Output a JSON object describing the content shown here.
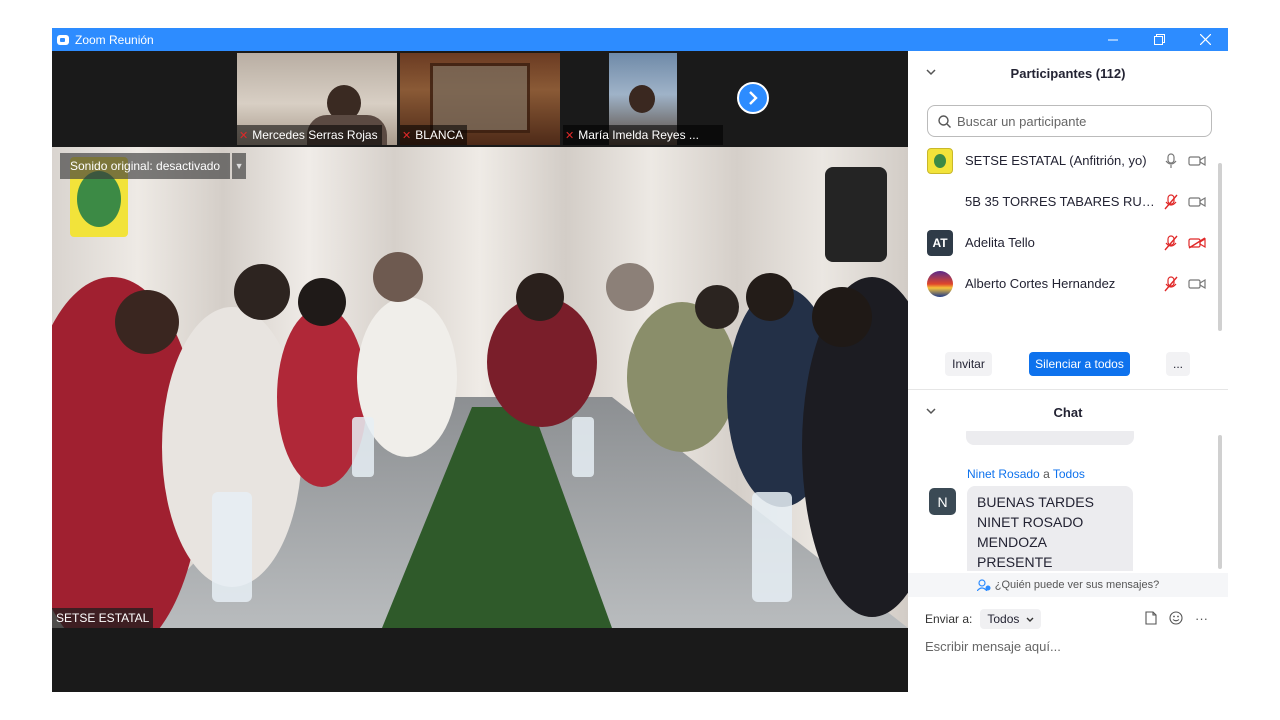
{
  "window": {
    "title": "Zoom Reunión"
  },
  "thumbnails": [
    {
      "name": "Mercedes Serras Rojas"
    },
    {
      "name": "BLANCA"
    },
    {
      "name": "María Imelda Reyes ..."
    }
  ],
  "main_video": {
    "original_sound": "Sonido original: desactivado",
    "speaker_name": "SETSE ESTATAL"
  },
  "participants": {
    "header": "Participantes (112)",
    "search_placeholder": "Buscar un participante",
    "list": [
      {
        "name": "SETSE ESTATAL (Anfitrión, yo)",
        "avatar": "",
        "mic": "on",
        "video": "on"
      },
      {
        "name": "5B 35 TORRES TABARES RUBEN ...",
        "avatar": "",
        "mic": "off",
        "video": "on"
      },
      {
        "name": "Adelita Tello",
        "avatar": "AT",
        "mic": "off",
        "video": "off"
      },
      {
        "name": "Alberto Cortes Hernandez",
        "avatar": "",
        "mic": "off",
        "video": "on"
      }
    ],
    "invite_label": "Invitar",
    "mute_all_label": "Silenciar a todos",
    "more_label": "..."
  },
  "chat": {
    "header": "Chat",
    "message": {
      "sender": "Ninet Rosado",
      "to_word": "a",
      "recipient": "Todos",
      "avatar_letter": "N",
      "lines": [
        "BUENAS TARDES",
        "NINET ROSADO",
        "MENDOZA PRESENTE"
      ]
    },
    "who_can_see": "¿Quién puede ver sus mensajes?",
    "send_to_label": "Enviar a:",
    "send_to_value": "Todos",
    "input_placeholder": "Escribir mensaje aquí..."
  },
  "colors": {
    "titlebar": "#2d8cff",
    "accent": "#0e72ed",
    "mute_red": "#e02828"
  }
}
